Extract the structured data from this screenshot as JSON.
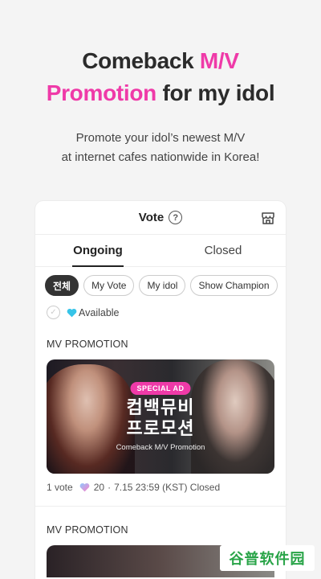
{
  "hero": {
    "line1_plain": "Comeback ",
    "line1_pink": "M/V",
    "line2_pink": "Promotion",
    "line2_plain": " for my idol",
    "sub_line1": "Promote your idol’s newest M/V",
    "sub_line2": "at internet cafes nationwide in Korea!"
  },
  "card": {
    "title": "Vote",
    "help_glyph": "?",
    "tabs": [
      {
        "label": "Ongoing",
        "active": true
      },
      {
        "label": "Closed",
        "active": false
      }
    ],
    "filters": [
      "전체",
      "My Vote",
      "My idol",
      "Show Champion"
    ],
    "available_label": "Available",
    "check_glyph": "✓"
  },
  "items": [
    {
      "section": "MV PROMOTION",
      "badge": "SPECIAL AD",
      "kr_line1": "컴백뮤비",
      "kr_line2": "프로모션",
      "en_caption": "Comeback M/V Promotion",
      "votes": "1 vote",
      "hearts": "20",
      "separator": "·",
      "deadline": "7.15 23:59 (KST) Closed"
    },
    {
      "section": "MV PROMOTION"
    }
  ],
  "watermark": "谷普软件园",
  "colors": {
    "accent_pink": "#ef3aa8",
    "heart_cyan": "#37c4e8",
    "heart_pink_gradient": [
      "#8fc8ff",
      "#ff7fc8"
    ],
    "watermark_green": "#29a448"
  },
  "icons": {
    "help": "question-circle-icon",
    "store": "store-icon",
    "check": "check-circle-icon",
    "available_heart": "heart-icon",
    "vote_heart": "heart-gradient-icon"
  }
}
